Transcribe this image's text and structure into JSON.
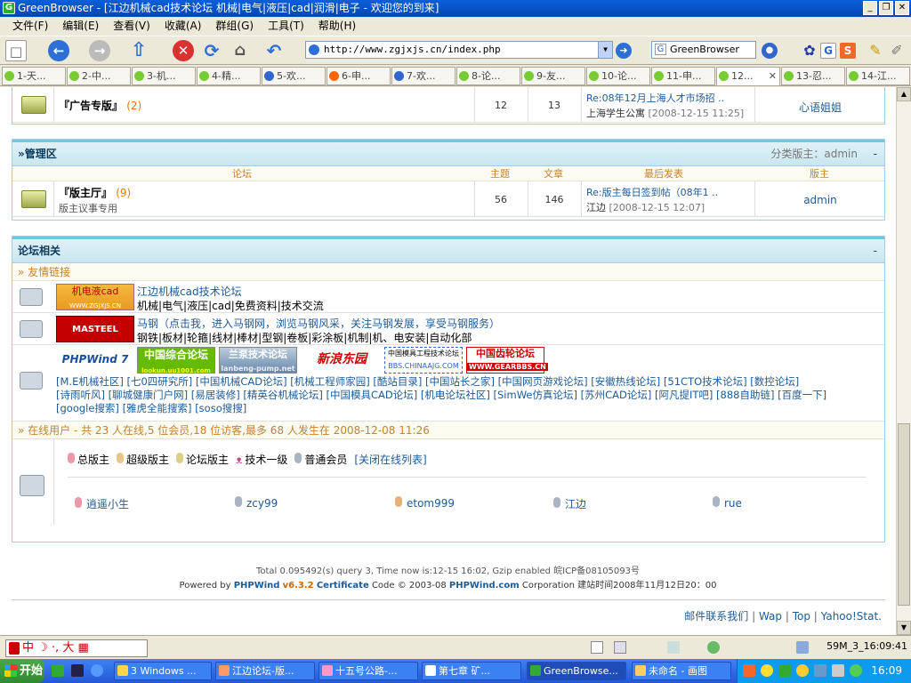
{
  "window": {
    "title": "GreenBrowser - [江边机械cad技术论坛 机械|电气|液压|cad|润滑|电子 - 欢迎您的到来]",
    "app_icon": "G"
  },
  "menu": [
    "文件(F)",
    "编辑(E)",
    "查看(V)",
    "收藏(A)",
    "群组(G)",
    "工具(T)",
    "帮助(H)"
  ],
  "address": {
    "url": "http://www.zgjxjs.cn/index.php"
  },
  "search": {
    "engine": "GreenBrowser"
  },
  "tabs": [
    "1-天...",
    "2-中...",
    "3-机...",
    "4-精...",
    "5-欢...",
    "6-申...",
    "7-欢...",
    "8-论...",
    "9-友...",
    "10-论...",
    "11-申...",
    "12...",
    "13-忍...",
    "14-江..."
  ],
  "forum_top": {
    "name": "『广告专版』",
    "count": "(2)",
    "topics": "12",
    "posts": "13",
    "last_post_title": "Re:08年12月上海人才市场招 ..",
    "last_post_by": "上海学生公寓",
    "last_post_time": "[2008-12-15 11:25]",
    "moderator": "心语姐姐"
  },
  "admin_zone": {
    "title": "»管理区",
    "moderator_label": "分类版主：admin",
    "collapse": "-",
    "col_forum": "论坛",
    "col_topics": "主题",
    "col_posts": "文章",
    "col_last": "最后发表",
    "col_mod": "版主",
    "forum_name": "『版主厅』",
    "forum_count": "(9)",
    "forum_desc": "版主议事专用",
    "topics": "56",
    "posts": "146",
    "last_post_title": "Re:版主每日签到帖（08年1 ..",
    "last_post_by": "江边",
    "last_post_time": "[2008-12-15 12:07]",
    "moderator": "admin"
  },
  "related": {
    "title": "论坛相关",
    "collapse": "-",
    "friend_links_label": "» 友情链接",
    "link1_logo": "机电液cad",
    "link1_logo_url": "WWW.ZGJXJS.CN",
    "link1_title": "江边机械cad技术论坛",
    "link1_desc": "机械|电气|液压|cad|免费资料|技术交流",
    "link2_logo": "MASTEEL",
    "link2_title": "马钢（点击我，进入马钢网，浏览马钢风采，关注马钢发展，享受马钢服务）",
    "link2_desc": "钢铁|板材|轮箍|线材|棒材|型钢|卷板|彩涂板|机制|机、电安装|自动化部",
    "banners": [
      "PHPWind 7",
      "中国综合论坛",
      "兰泵技术论坛",
      "新浪东园",
      "中国模具工程技术论坛",
      "中国齿轮论坛"
    ],
    "banner_subs": [
      "",
      "lookun.uu1001.com",
      "lanbeng-pump.net",
      "",
      "BBS.CHINAAJG.COM",
      "WWW.GEARBBS.CN"
    ],
    "text_links_line1": "[M.E机械社区] [七0四研究所] [中国机械CAD论坛] [机械工程师家园] [酷站目录] [中国站长之家] [中国网页游戏论坛] [安徽热线论坛] [51CTO技术论坛] [数控论坛]",
    "text_links_line2": "[诗雨听风] [聊城健康门户网] [易居装修] [精英谷机械论坛] [中国模具CAD论坛] [机电论坛社区] [SimWe仿真论坛] [苏州CAD论坛] [阿凡提IT吧] [888自助链] [百度一下]",
    "text_links_line3": "[google搜索] [雅虎全能搜索] [soso搜搜]",
    "online_label": "» 在线用户 - 共 23 人在线,5 位会员,18 位访客,最多 68 人发生在 2008-12-08 11:26",
    "legend": [
      "总版主",
      "超级版主",
      "论坛版主",
      "技术一级",
      "普通会员"
    ],
    "legend_close": "[关闭在线列表]",
    "online_users": [
      "逍遥小生",
      "zcy99",
      "etom999",
      "江边",
      "rue"
    ]
  },
  "footer": {
    "stats": "Total 0.095492(s) query 3, Time now is:12-15 16:02, Gzip enabled 皖ICP备08105093号",
    "powered_prefix": "Powered by",
    "powered_brand": "PHPWind",
    "powered_version": "v6.3.2",
    "powered_cert": "Certificate",
    "powered_code": "Code © 2003-08",
    "powered_site": "PHPWind.com",
    "powered_corp": "Corporation 建站时间2008年11月12日20：00",
    "bottom_links": [
      "邮件联系我们",
      "Wap",
      "Top",
      "Yahoo!Stat."
    ]
  },
  "statusbar": {
    "ime": "中 ☽ ·, 大 ▦",
    "right": "59M_3_16:09:41"
  },
  "taskbar": {
    "start": "开始",
    "items": [
      "3 Windows ...",
      "江边论坛-版...",
      "十五号公路-...",
      "第七章   矿...",
      "GreenBrowse...",
      "未命名 - 画图"
    ],
    "clock": "16:09"
  },
  "colors": {
    "accent": "#1e5a96",
    "header_bar": "#71c6dd",
    "count": "#e17a00",
    "section": "#c6822e"
  }
}
